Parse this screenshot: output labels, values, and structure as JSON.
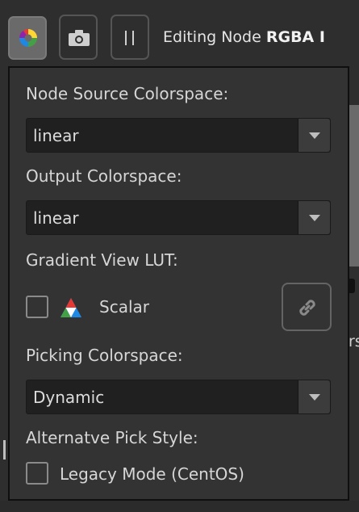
{
  "toolbar": {
    "title_prefix": "Editing Node ",
    "title_bold": "RGBA I",
    "buttons": [
      {
        "icon": "color-wheel-icon",
        "active": true
      },
      {
        "icon": "camera-icon"
      },
      {
        "icon": "pause-icon"
      }
    ]
  },
  "background": {
    "right_text": "rs"
  },
  "panel": {
    "node_source": {
      "label": "Node Source Colorspace:",
      "value": "linear"
    },
    "output": {
      "label": "Output Colorspace:",
      "value": "linear"
    },
    "gradient": {
      "label": "Gradient View LUT:",
      "checked": false,
      "item_label": "Scalar",
      "icon": "rgb-triangle-icon",
      "link_icon": "link-icon"
    },
    "picking": {
      "label": "Picking Colorspace:",
      "value": "Dynamic"
    },
    "alt_pick": {
      "label": "Alternatve Pick Style:",
      "checkbox_label": "Legacy Mode (CentOS)",
      "checked": false
    }
  },
  "colors": {
    "panel_bg": "#333333",
    "combo_bg": "#202020",
    "text": "#d6d6d6"
  }
}
